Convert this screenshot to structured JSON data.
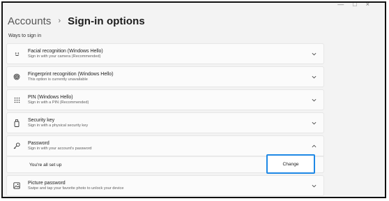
{
  "window": {
    "controls": [
      "—",
      "□",
      "×"
    ]
  },
  "header": {
    "breadcrumb_parent": "Accounts",
    "separator": "›",
    "title": "Sign-in options"
  },
  "section_label": "Ways to sign in",
  "options": [
    {
      "title": "Facial recognition (Windows Hello)",
      "subtitle": "Sign in with your camera (Recommended)",
      "icon": "smile-icon"
    },
    {
      "title": "Fingerprint recognition (Windows Hello)",
      "subtitle": "This option is currently unavailable",
      "icon": "fingerprint-icon"
    },
    {
      "title": "PIN (Windows Hello)",
      "subtitle": "Sign in with a PIN (Recommended)",
      "icon": "keypad-icon"
    },
    {
      "title": "Security key",
      "subtitle": "Sign in with a physical security key",
      "icon": "usb-key-icon"
    },
    {
      "title": "Password",
      "subtitle": "Sign in with your account's password",
      "icon": "key-icon"
    },
    {
      "title": "Picture password",
      "subtitle": "Swipe and tap your favorite photo to unlock your device",
      "icon": "picture-icon"
    }
  ],
  "password_panel": {
    "status": "You're all set up",
    "button_label": "Change"
  },
  "colors": {
    "accent": "#1e88e5",
    "page_background": "#f3f3f3",
    "card_background": "#fbfbfb"
  }
}
